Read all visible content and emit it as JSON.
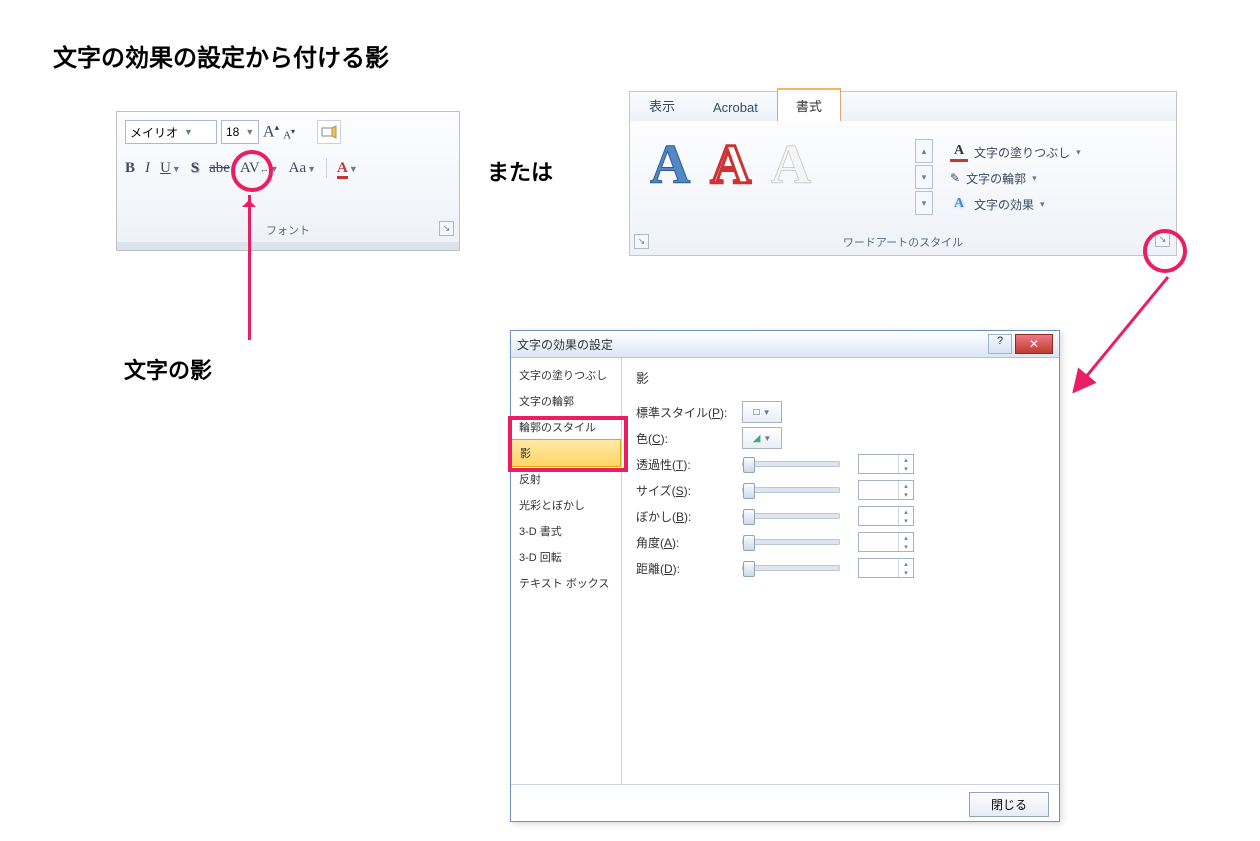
{
  "title": "文字の効果の設定から付ける影",
  "sub_label": "文字の影",
  "or_label": "または",
  "font_panel": {
    "font_name": "メイリオ",
    "font_size": "18",
    "group_label": "フォント",
    "btn_bold": "B",
    "btn_italic": "I",
    "btn_underline": "U",
    "btn_shadow": "S",
    "btn_strike": "abe",
    "btn_spacing": "AV",
    "btn_case": "Aa",
    "btn_color": "A"
  },
  "ribbon": {
    "tabs": [
      "表示",
      "Acrobat",
      "書式"
    ],
    "opt_fill": "文字の塗りつぶし",
    "opt_outline": "文字の輪郭",
    "opt_effect": "文字の効果",
    "group_label": "ワードアートのスタイル"
  },
  "dialog": {
    "title": "文字の効果の設定",
    "close_btn": "閉じる",
    "side_items": [
      "文字の塗りつぶし",
      "文字の輪郭",
      "輪郭のスタイル",
      "影",
      "反射",
      "光彩とぼかし",
      "3-D 書式",
      "3-D 回転",
      "テキスト ボックス"
    ],
    "selected_index": 3,
    "panel_heading": "影",
    "row_preset": "標準スタイル(P):",
    "row_color": "色(C):",
    "row_trans": "透過性(T):",
    "row_size": "サイズ(S):",
    "row_blur": "ぼかし(B):",
    "row_angle": "角度(A):",
    "row_dist": "距離(D):"
  }
}
